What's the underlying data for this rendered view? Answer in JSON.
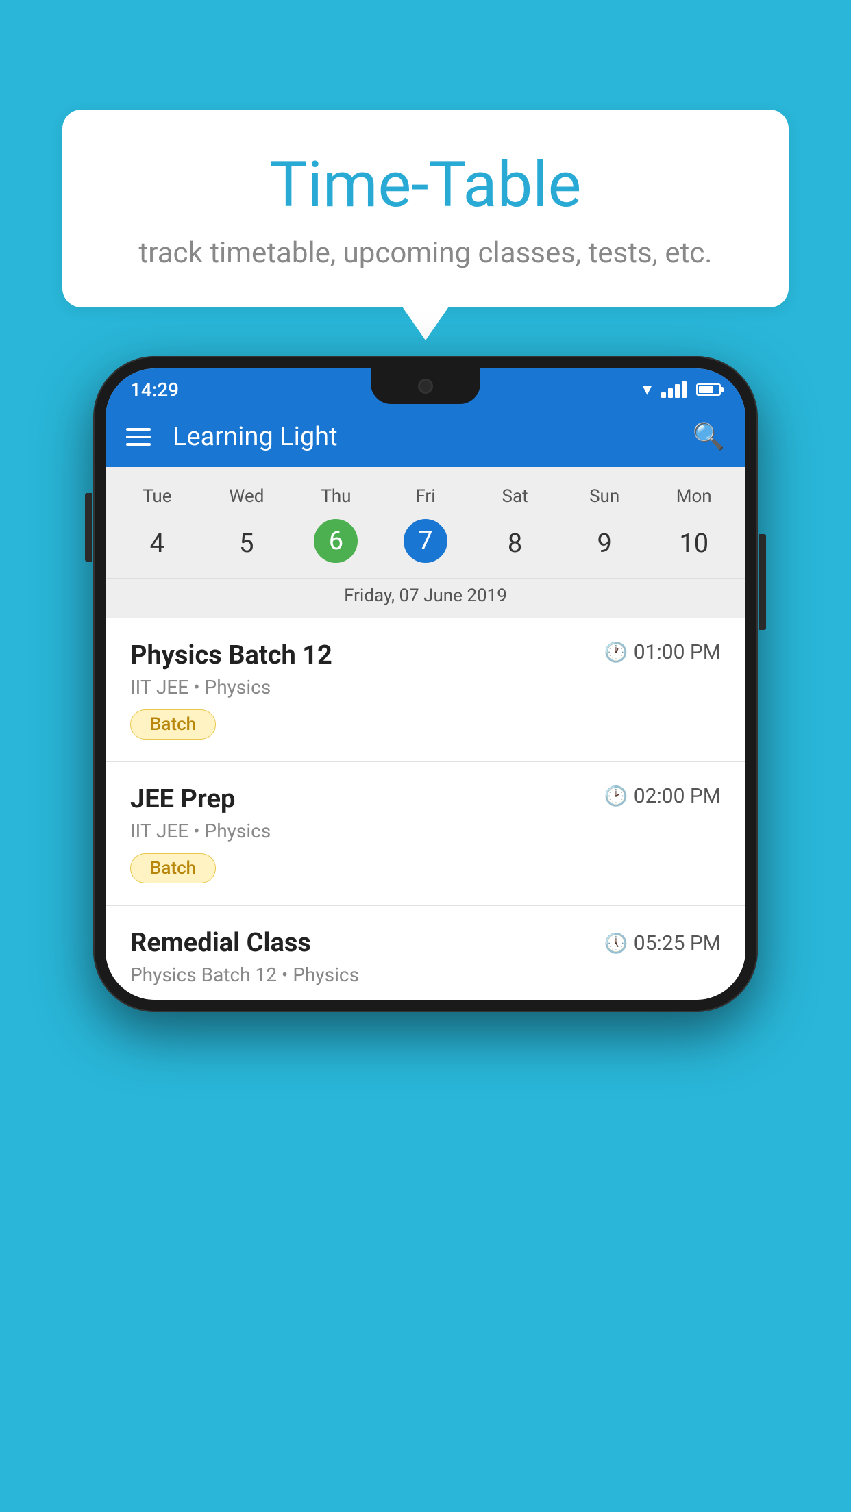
{
  "background": {
    "color": "#29b6d8"
  },
  "bubble": {
    "title": "Time-Table",
    "subtitle": "track timetable, upcoming classes, tests, etc."
  },
  "phone": {
    "status_bar": {
      "time": "14:29"
    },
    "app_bar": {
      "title": "Learning Light",
      "menu_icon": "menu",
      "search_icon": "search"
    },
    "calendar": {
      "days": [
        "Tue",
        "Wed",
        "Thu",
        "Fri",
        "Sat",
        "Sun",
        "Mon"
      ],
      "dates": [
        "4",
        "5",
        "6",
        "7",
        "8",
        "9",
        "10"
      ],
      "today_index": 2,
      "selected_index": 3,
      "selected_date_label": "Friday, 07 June 2019"
    },
    "schedule": [
      {
        "name": "Physics Batch 12",
        "time": "01:00 PM",
        "sub": "IIT JEE • Physics",
        "badge": "Batch"
      },
      {
        "name": "JEE Prep",
        "time": "02:00 PM",
        "sub": "IIT JEE • Physics",
        "badge": "Batch"
      },
      {
        "name": "Remedial Class",
        "time": "05:25 PM",
        "sub": "Physics Batch 12 • Physics",
        "badge": null
      }
    ]
  }
}
